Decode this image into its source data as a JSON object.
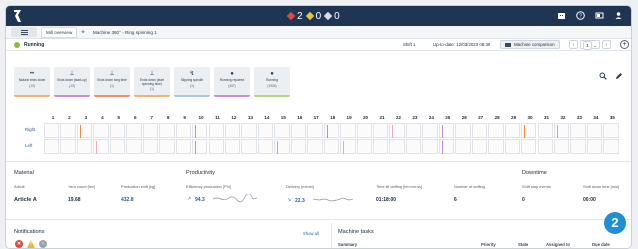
{
  "topbar": {
    "counts": [
      {
        "color": "#e04a3c",
        "value": "2",
        "icon": "red-diamond-icon"
      },
      {
        "color": "#e8c33c",
        "value": "0",
        "icon": "yellow-diamond-icon"
      },
      {
        "color": "#d8dde3",
        "value": "0",
        "icon": "grey-diamond-icon"
      }
    ],
    "icons": [
      "building-icon",
      "help-icon",
      "dashboard-icon",
      "user-icon"
    ]
  },
  "breadcrumb": {
    "items": [
      "Mill overview",
      "Machine 360° - Ring spinning 1"
    ]
  },
  "status": {
    "state": "Running",
    "shift": "Shift 1",
    "up_to_date": "Up-to-date: 12/03/2023 08:36",
    "machine_comparison": "Machine comparison",
    "page": "1",
    "prev": "‹",
    "next": "›"
  },
  "cards": [
    {
      "icon": "••",
      "label": "Natural ends down",
      "value": "(13)",
      "bar": "#f2b26b"
    },
    {
      "icon": "⊥",
      "label": "Ends down (start-up)",
      "value": "(13)",
      "bar": "#c98fd6"
    },
    {
      "icon": "⊥",
      "label": "Ends down long time",
      "value": "(1)",
      "bar": "#f28c6b"
    },
    {
      "icon": "⊥",
      "label": "Ends down (start spinning time)",
      "value": "(1)",
      "bar": "#f2b26b"
    },
    {
      "icon": "↯",
      "label": "Slipping spindle",
      "value": "(1)",
      "bar": "#a9c7ea"
    },
    {
      "icon": "●",
      "label": "Running repaired",
      "value": "(457)",
      "bar": "#c98fd6"
    },
    {
      "icon": "●",
      "label": "Running",
      "value": "(1934)",
      "bar": "#b7d68a"
    }
  ],
  "tools": [
    "search-icon",
    "pen-icon"
  ],
  "spindles": {
    "numbers": [
      "1",
      "2",
      "3",
      "4",
      "5",
      "6",
      "7",
      "8",
      "9",
      "10",
      "11",
      "12",
      "13",
      "14",
      "15",
      "16",
      "17",
      "18",
      "19",
      "20",
      "21",
      "22",
      "23",
      "24",
      "25",
      "26",
      "27",
      "28",
      "29",
      "30",
      "31",
      "32",
      "33",
      "34",
      "35"
    ],
    "rows": [
      "Right",
      "Left"
    ],
    "colors": {
      "orange": "#f0883e",
      "purple": "#b98be0",
      "pink": "#f2a7c0",
      "blue": "#8cb8ea"
    }
  },
  "material": {
    "title": "Material",
    "article_label": "Article",
    "article_value": "Article A",
    "yarn_label": "Yarn count [tex]",
    "yarn_value": "19.68",
    "prod_label": "Production shift [kg]",
    "prod_value": "432.8"
  },
  "productivity": {
    "title": "Productivity",
    "eff_label": "Efficiency production [P%]",
    "eff_value": "94.3",
    "del_label": "Delivery [m/min]",
    "del_value": "22.3",
    "doff_time_label": "Time till doffing [hh:mm:ss]",
    "doff_time_value": "01:18:00",
    "doff_count_label": "Number of doffing",
    "doff_count_value": "6"
  },
  "downtime": {
    "title": "Downtime",
    "events_label": "Shift stop events",
    "events_value": "0",
    "time_label": "Shift down time [min]",
    "time_value": "00:00"
  },
  "notifications": {
    "title": "Notifications",
    "show_all": "Show all",
    "icons": [
      {
        "icon": "error-icon",
        "color": "#e04a3c",
        "glyph": "✕"
      },
      {
        "icon": "warning-icon",
        "color": "#e8b92c",
        "glyph": "!"
      },
      {
        "icon": "info-icon",
        "color": "#9aa3ad",
        "glyph": "○"
      }
    ]
  },
  "tasks": {
    "title": "Machine tasks",
    "columns": [
      "Summary",
      "Priority",
      "State",
      "Assigned to",
      "Due date"
    ]
  },
  "badge": "2"
}
